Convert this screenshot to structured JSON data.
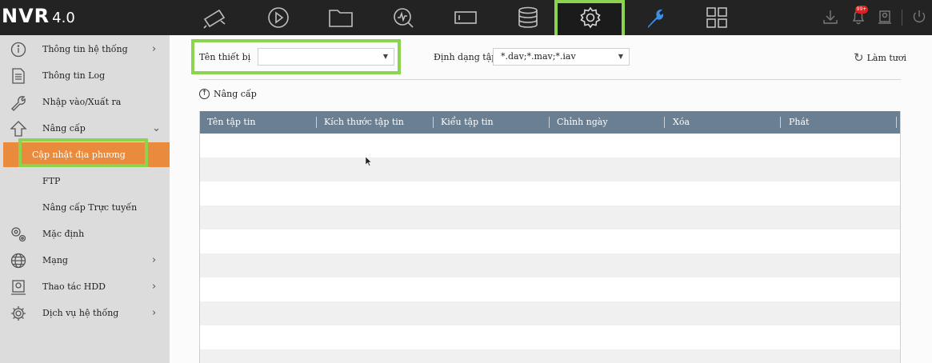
{
  "app": {
    "brand": "NVR",
    "version": "4.0"
  },
  "topnav": {
    "items": [
      "camera-icon",
      "playback-icon",
      "folder-icon",
      "search-analytics-icon",
      "device-icon",
      "storage-icon",
      "gear-icon",
      "wrench-icon",
      "grid-icon"
    ],
    "active": "gear-icon",
    "badge": "99+"
  },
  "sidebar": {
    "items": [
      {
        "label": "Thông tin hệ thống",
        "icon": "info-icon",
        "chevron": "›"
      },
      {
        "label": "Thông tin Log",
        "icon": "document-icon"
      },
      {
        "label": "Nhập vào/Xuất ra",
        "icon": "wrench-icon"
      },
      {
        "label": "Nâng cấp",
        "icon": "upgrade-icon",
        "chevron": "⌄"
      },
      {
        "label": "Cập nhật địa phương",
        "sub": true,
        "active": true
      },
      {
        "label": "FTP",
        "sub": true
      },
      {
        "label": "Nâng cấp Trực tuyến",
        "sub": true
      },
      {
        "label": "Mặc định",
        "icon": "gears-icon"
      },
      {
        "label": "Mạng",
        "icon": "globe-icon",
        "chevron": "›"
      },
      {
        "label": "Thao tác HDD",
        "icon": "hdd-icon",
        "chevron": "›"
      },
      {
        "label": "Dịch vụ hệ thống",
        "icon": "settings-icon",
        "chevron": "›"
      }
    ]
  },
  "form": {
    "device_label": "Tên thiết bị",
    "device_value": "",
    "format_label": "Định dạng tập ...",
    "format_value": "*.dav;*.mav;*.iav",
    "refresh_label": "Làm tươi",
    "upgrade_label": "Nâng cấp"
  },
  "table": {
    "columns": [
      "Tên tập tin",
      "Kích thước tập tin",
      "Kiểu tập tin",
      "Chỉnh ngày",
      "Xóa",
      "Phát"
    ]
  },
  "colors": {
    "accent": "#ea8a3c",
    "highlight": "#8cd34f",
    "header": "#6a7f92",
    "topbar": "#232323"
  }
}
